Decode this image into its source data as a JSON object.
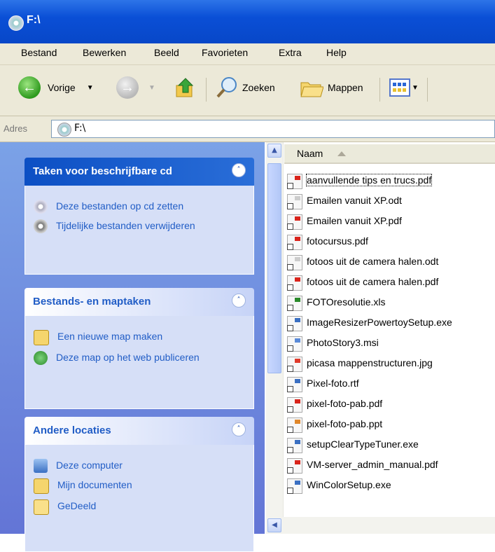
{
  "window": {
    "title": "F:\\"
  },
  "menu": [
    "Bestand",
    "Bewerken",
    "Beeld",
    "Favorieten",
    "Extra",
    "Help"
  ],
  "toolbar": {
    "back": "Vorige",
    "search": "Zoeken",
    "folders": "Mappen"
  },
  "address": {
    "label": "Adres",
    "value": "F:\\"
  },
  "panels": [
    {
      "title": "Taken voor beschrijfbare cd",
      "tasks": [
        "Deze bestanden op cd zetten",
        "Tijdelijke bestanden verwijderen"
      ]
    },
    {
      "title": "Bestands- en maptaken",
      "tasks": [
        "Een nieuwe map maken",
        "Deze map op het web publiceren"
      ]
    },
    {
      "title": "Andere locaties",
      "tasks": [
        "Deze computer",
        "Mijn documenten",
        "GeDeeld"
      ]
    }
  ],
  "files": {
    "column": "Naam",
    "items": [
      "aanvullende tips en trucs.pdf",
      "Emailen vanuit XP.odt",
      "Emailen vanuit XP.pdf",
      "fotocursus.pdf",
      "fotoos uit de camera halen.odt",
      "fotoos uit de camera halen.pdf",
      "FOTOresolutie.xls",
      "ImageResizerPowertoySetup.exe",
      "PhotoStory3.msi",
      "picasa mappenstructuren.jpg",
      "Pixel-foto.rtf",
      "pixel-foto-pab.pdf",
      "pixel-foto-pab.ppt",
      "setupClearTypeTuner.exe",
      "VM-server_admin_manual.pdf",
      "WinColorSetup.exe"
    ]
  },
  "colors": {
    "title_bar": "#0a4fd6",
    "panel_link": "#215dc6",
    "left_pane": "#6f8ee0"
  }
}
